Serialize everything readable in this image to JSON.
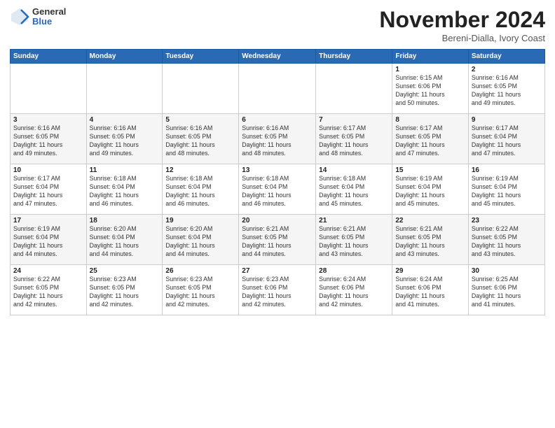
{
  "header": {
    "logo_general": "General",
    "logo_blue": "Blue",
    "month_title": "November 2024",
    "subtitle": "Bereni-Dialla, Ivory Coast"
  },
  "days_of_week": [
    "Sunday",
    "Monday",
    "Tuesday",
    "Wednesday",
    "Thursday",
    "Friday",
    "Saturday"
  ],
  "weeks": [
    [
      {
        "day": "",
        "info": ""
      },
      {
        "day": "",
        "info": ""
      },
      {
        "day": "",
        "info": ""
      },
      {
        "day": "",
        "info": ""
      },
      {
        "day": "",
        "info": ""
      },
      {
        "day": "1",
        "info": "Sunrise: 6:15 AM\nSunset: 6:06 PM\nDaylight: 11 hours\nand 50 minutes."
      },
      {
        "day": "2",
        "info": "Sunrise: 6:16 AM\nSunset: 6:05 PM\nDaylight: 11 hours\nand 49 minutes."
      }
    ],
    [
      {
        "day": "3",
        "info": "Sunrise: 6:16 AM\nSunset: 6:05 PM\nDaylight: 11 hours\nand 49 minutes."
      },
      {
        "day": "4",
        "info": "Sunrise: 6:16 AM\nSunset: 6:05 PM\nDaylight: 11 hours\nand 49 minutes."
      },
      {
        "day": "5",
        "info": "Sunrise: 6:16 AM\nSunset: 6:05 PM\nDaylight: 11 hours\nand 48 minutes."
      },
      {
        "day": "6",
        "info": "Sunrise: 6:16 AM\nSunset: 6:05 PM\nDaylight: 11 hours\nand 48 minutes."
      },
      {
        "day": "7",
        "info": "Sunrise: 6:17 AM\nSunset: 6:05 PM\nDaylight: 11 hours\nand 48 minutes."
      },
      {
        "day": "8",
        "info": "Sunrise: 6:17 AM\nSunset: 6:05 PM\nDaylight: 11 hours\nand 47 minutes."
      },
      {
        "day": "9",
        "info": "Sunrise: 6:17 AM\nSunset: 6:04 PM\nDaylight: 11 hours\nand 47 minutes."
      }
    ],
    [
      {
        "day": "10",
        "info": "Sunrise: 6:17 AM\nSunset: 6:04 PM\nDaylight: 11 hours\nand 47 minutes."
      },
      {
        "day": "11",
        "info": "Sunrise: 6:18 AM\nSunset: 6:04 PM\nDaylight: 11 hours\nand 46 minutes."
      },
      {
        "day": "12",
        "info": "Sunrise: 6:18 AM\nSunset: 6:04 PM\nDaylight: 11 hours\nand 46 minutes."
      },
      {
        "day": "13",
        "info": "Sunrise: 6:18 AM\nSunset: 6:04 PM\nDaylight: 11 hours\nand 46 minutes."
      },
      {
        "day": "14",
        "info": "Sunrise: 6:18 AM\nSunset: 6:04 PM\nDaylight: 11 hours\nand 45 minutes."
      },
      {
        "day": "15",
        "info": "Sunrise: 6:19 AM\nSunset: 6:04 PM\nDaylight: 11 hours\nand 45 minutes."
      },
      {
        "day": "16",
        "info": "Sunrise: 6:19 AM\nSunset: 6:04 PM\nDaylight: 11 hours\nand 45 minutes."
      }
    ],
    [
      {
        "day": "17",
        "info": "Sunrise: 6:19 AM\nSunset: 6:04 PM\nDaylight: 11 hours\nand 44 minutes."
      },
      {
        "day": "18",
        "info": "Sunrise: 6:20 AM\nSunset: 6:04 PM\nDaylight: 11 hours\nand 44 minutes."
      },
      {
        "day": "19",
        "info": "Sunrise: 6:20 AM\nSunset: 6:04 PM\nDaylight: 11 hours\nand 44 minutes."
      },
      {
        "day": "20",
        "info": "Sunrise: 6:21 AM\nSunset: 6:05 PM\nDaylight: 11 hours\nand 44 minutes."
      },
      {
        "day": "21",
        "info": "Sunrise: 6:21 AM\nSunset: 6:05 PM\nDaylight: 11 hours\nand 43 minutes."
      },
      {
        "day": "22",
        "info": "Sunrise: 6:21 AM\nSunset: 6:05 PM\nDaylight: 11 hours\nand 43 minutes."
      },
      {
        "day": "23",
        "info": "Sunrise: 6:22 AM\nSunset: 6:05 PM\nDaylight: 11 hours\nand 43 minutes."
      }
    ],
    [
      {
        "day": "24",
        "info": "Sunrise: 6:22 AM\nSunset: 6:05 PM\nDaylight: 11 hours\nand 42 minutes."
      },
      {
        "day": "25",
        "info": "Sunrise: 6:23 AM\nSunset: 6:05 PM\nDaylight: 11 hours\nand 42 minutes."
      },
      {
        "day": "26",
        "info": "Sunrise: 6:23 AM\nSunset: 6:05 PM\nDaylight: 11 hours\nand 42 minutes."
      },
      {
        "day": "27",
        "info": "Sunrise: 6:23 AM\nSunset: 6:06 PM\nDaylight: 11 hours\nand 42 minutes."
      },
      {
        "day": "28",
        "info": "Sunrise: 6:24 AM\nSunset: 6:06 PM\nDaylight: 11 hours\nand 42 minutes."
      },
      {
        "day": "29",
        "info": "Sunrise: 6:24 AM\nSunset: 6:06 PM\nDaylight: 11 hours\nand 41 minutes."
      },
      {
        "day": "30",
        "info": "Sunrise: 6:25 AM\nSunset: 6:06 PM\nDaylight: 11 hours\nand 41 minutes."
      }
    ]
  ]
}
